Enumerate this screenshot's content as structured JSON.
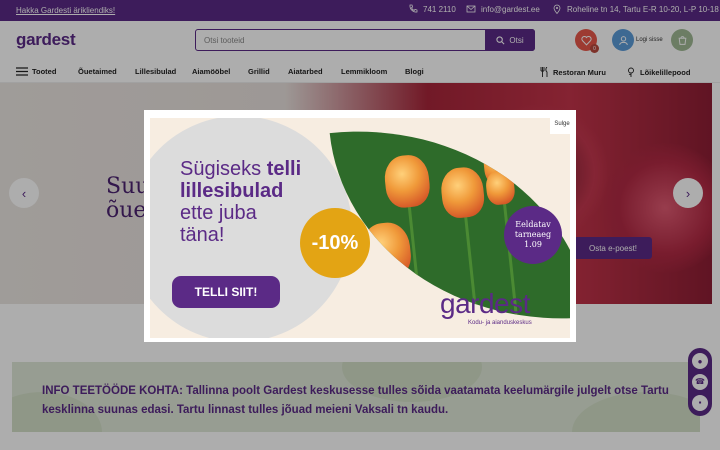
{
  "topbar": {
    "promo_link": "Hakka Gardesti ärikliendiks!",
    "phone": "741 2110",
    "email": "info@gardest.ee",
    "address": "Roheline tn 14, Tartu E-R 10-20, L-P 10-18"
  },
  "header": {
    "logo": "gardest",
    "search_placeholder": "Otsi tooteid",
    "search_button": "Otsi",
    "wishlist_count": "0",
    "login_label": "Logi sisse"
  },
  "nav": {
    "menu_label": "Tooted",
    "items": [
      "Õuetaimed",
      "Lillesibulad",
      "Aiamööbel",
      "Grillid",
      "Aiatarbed",
      "Lemmikloom",
      "Blogi"
    ],
    "restaurant": "Restoran Muru",
    "florist": "Lõikelillepood"
  },
  "hero": {
    "title_line1": "Suu",
    "title_line2": "õue",
    "button": "Osta e-poest!",
    "prev": "‹",
    "next": "›"
  },
  "modal": {
    "close_label": "Sulge",
    "headline_part1": "Sügiseks ",
    "headline_bold1": "telli",
    "headline_bold2": "lillesibulad",
    "headline_line3": "ette juba",
    "headline_line4": "täna!",
    "cta": "TELLI SIIT!",
    "discount": "-10%",
    "badge_line1": "Eeldatav",
    "badge_line2": "tarneaeg",
    "badge_line3": "1.09",
    "brand": "gardest",
    "brand_sub": "Kodu- ja aianduskeskus"
  },
  "info": {
    "text": "INFO TEETÖÖDE KOHTA: Tallinna poolt Gardest keskusesse tulles sõida vaatamata keelumärgile julgelt otse Tartu kesklinna suunas edasi. Tartu linnast tulles jõuad meieni Vaksali tn kaudu."
  },
  "colors": {
    "brand_purple": "#5b2a86",
    "accent_orange": "#e3a414",
    "info_green": "#dfe8d7"
  }
}
